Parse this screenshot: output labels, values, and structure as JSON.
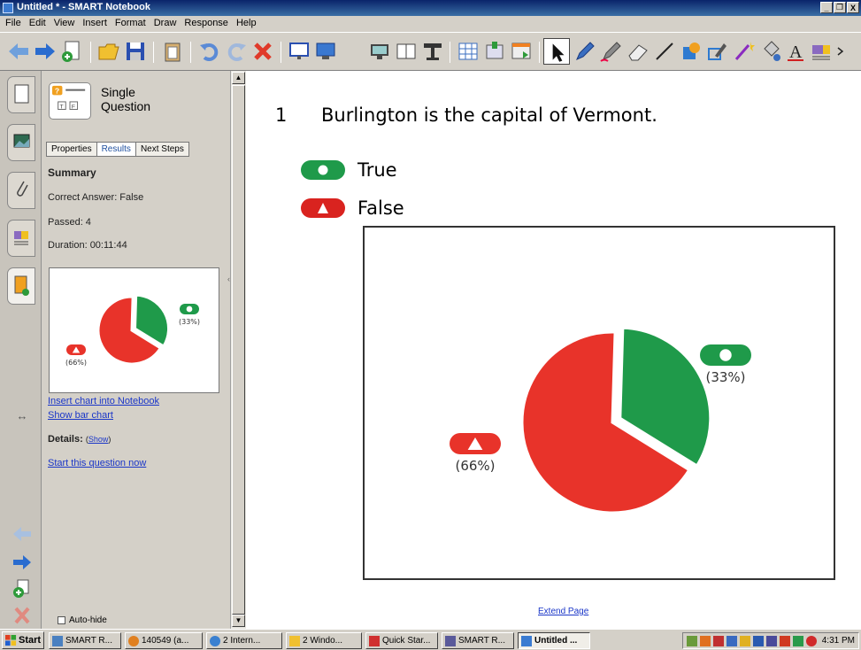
{
  "window": {
    "title": "Untitled * - SMART Notebook",
    "buttons": [
      "_",
      "8",
      "X"
    ]
  },
  "menu": [
    "File",
    "Edit",
    "View",
    "Insert",
    "Format",
    "Draw",
    "Response",
    "Help"
  ],
  "panel": {
    "question_type": "Single Question",
    "tabs": [
      "Properties",
      "Results",
      "Next Steps"
    ],
    "summary_heading": "Summary",
    "correct_answer": "Correct Answer: False",
    "passed": "Passed: 4",
    "duration": "Duration: 00:11:44",
    "insert_chart_link": "Insert chart into Notebook",
    "show_bar_chart_link": "Show bar chart",
    "details_label": "Details:",
    "details_paren_open": "(",
    "details_show_link": "Show",
    "details_paren_close": ")",
    "start_question_link": "Start this question now",
    "autohide_label": "Auto-hide"
  },
  "question": {
    "number": "1",
    "text": "Burlington is the capital of Vermont.",
    "answers": [
      {
        "label": "True",
        "color": "#1f9a4a",
        "symbol": "circle"
      },
      {
        "label": "False",
        "color": "#d9231f",
        "symbol": "triangle"
      }
    ]
  },
  "chart_data": {
    "type": "pie",
    "slices": [
      {
        "answer": "True",
        "percent": 33,
        "label": "(33%)",
        "color": "#1f9a4a"
      },
      {
        "answer": "False",
        "percent": 66,
        "label": "(66%)",
        "color": "#e8332a"
      }
    ]
  },
  "canvas": {
    "extend_link": "Extend Page"
  },
  "taskbar": {
    "start_label": "Start",
    "items": [
      "SMART R...",
      "140549 (a...",
      "2 Intern...",
      "2 Windo...",
      "Quick Star...",
      "SMART R...",
      "Untitled ..."
    ],
    "clock": "4:31 PM"
  }
}
